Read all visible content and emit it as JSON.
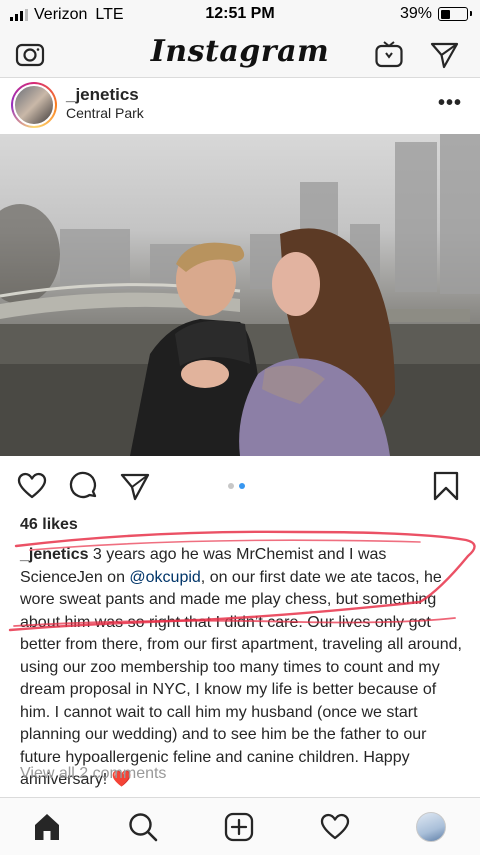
{
  "status_bar": {
    "carrier": "Verizon",
    "network": "LTE",
    "time": "12:51 PM",
    "battery": "39%",
    "battery_level": 0.39
  },
  "app_header": {
    "logo": "Instagram",
    "left_icon": "camera-icon",
    "right_icons": [
      "igtv-icon",
      "direct-message-icon"
    ]
  },
  "post": {
    "username": "_jenetics",
    "location": "Central Park",
    "more_label": "•••",
    "photo_description_icon": "photo",
    "carousel": {
      "total": 2,
      "active": 2
    },
    "likes": "46 likes",
    "caption": {
      "user": "_jenetics",
      "before_mention": " 3 years ago he was MrChemist and I was ScienceJen on ",
      "mention": "@okcupid",
      "after_mention": ", on our first date we ate tacos, he wore sweat pants and made me play chess, but something about him was so right that I didn’t care. Our lives only got better from there, from our first apartment, traveling all around, using our zoo membership too many times to count and my dream proposal in NYC, I know my life is better because of him. I cannot wait to call him my husband (once we start planning our wedding) and to see him be the father to our future hypoallergenic feline and canine children. Happy anniversary! ",
      "emoji": "❤️"
    },
    "view_comments": "View all 2 comments"
  },
  "bottom_nav": {
    "items": [
      "home-icon",
      "search-icon",
      "new-post-icon",
      "activity-icon",
      "profile-icon"
    ]
  },
  "colors": {
    "accent_blue": "#3897f0",
    "mention": "#003569",
    "annotation_red": "#e8324a"
  }
}
